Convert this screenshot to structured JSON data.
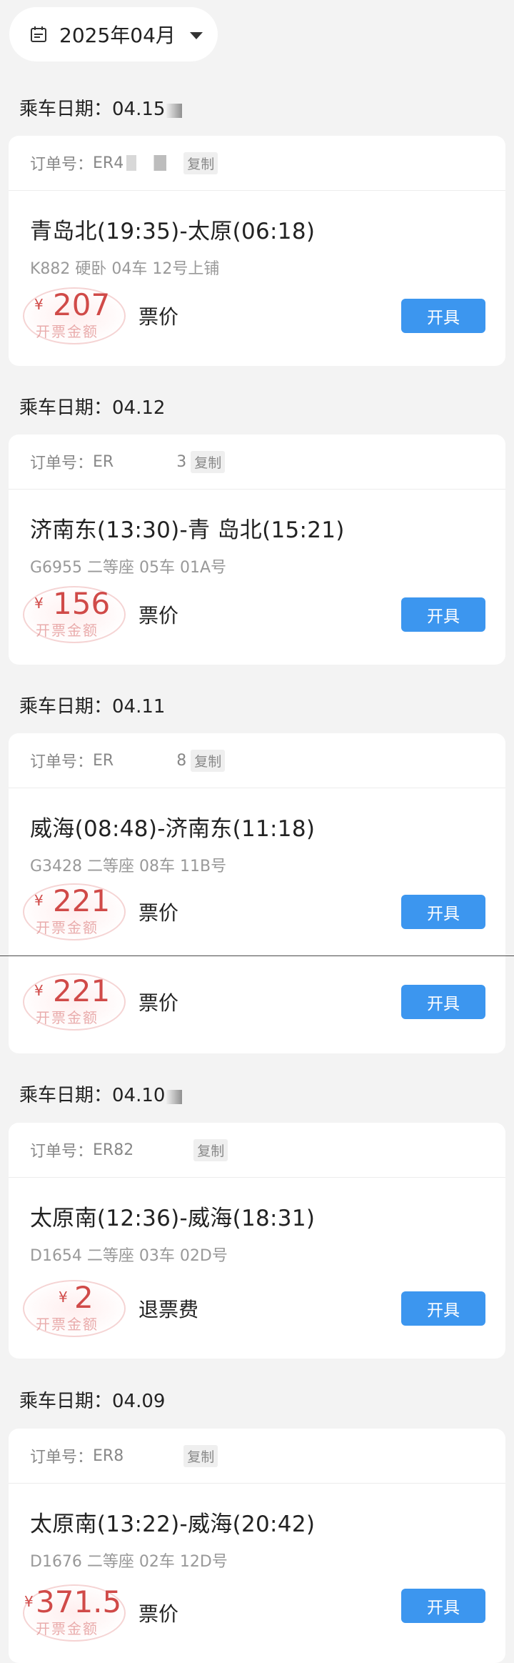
{
  "month_picker": {
    "label": "2025年04月"
  },
  "groups": [
    {
      "date_label": "乘车日期：",
      "date": "04.15",
      "order_label": "订单号：",
      "order_no": "ER4",
      "copy": "复制",
      "route": "青岛北(19:35)-太原(06:18)",
      "train": "K882 硬卧 04车 12号上铺",
      "yen": "¥",
      "amount": "207",
      "stamp_text": "开票金额",
      "fee_type": "票价",
      "button": "开具"
    },
    {
      "date_label": "乘车日期：",
      "date": "04.12",
      "order_label": "订单号：",
      "order_no": "ER",
      "order_tail": "3",
      "copy": "复制",
      "route": "济南东(13:30)-青 岛北(15:21)",
      "train": "G6955 二等座 05车 01A号",
      "yen": "¥",
      "amount": "156",
      "stamp_text": "开票金额",
      "fee_type": "票价",
      "button": "开具"
    },
    {
      "date_label": "乘车日期：",
      "date": "04.11",
      "order_label": "订单号：",
      "order_no": "ER",
      "order_tail": "8",
      "copy": "复制",
      "route": "威海(08:48)-济南东(11:18)",
      "train": "G3428 二等座 08车 11B号",
      "yen": "¥",
      "amount": "221",
      "stamp_text": "开票金额",
      "fee_type": "票价",
      "button": "开具",
      "extra_yen": "¥",
      "extra_amount": "221",
      "extra_stamp_text": "开票金额",
      "extra_fee_type": "票价",
      "extra_button": "开具"
    },
    {
      "date_label": "乘车日期：",
      "date": "04.10",
      "order_label": "订单号：",
      "order_no": "ER82",
      "copy": "复制",
      "route": "太原南(12:36)-威海(18:31)",
      "train": "D1654 二等座 03车 02D号",
      "yen": "¥",
      "amount": "2",
      "stamp_text": "开票金额",
      "fee_type": "退票费",
      "button": "开具"
    },
    {
      "date_label": "乘车日期：",
      "date": "04.09",
      "order_label": "订单号：",
      "order_no": "ER8",
      "copy": "复制",
      "route": "太原南(13:22)-威海(20:42)",
      "train": "D1676 二等座 02车 12D号",
      "yen": "¥",
      "amount": "371.5",
      "stamp_text": "开票金额",
      "fee_type": "票价",
      "button": "开具"
    }
  ]
}
